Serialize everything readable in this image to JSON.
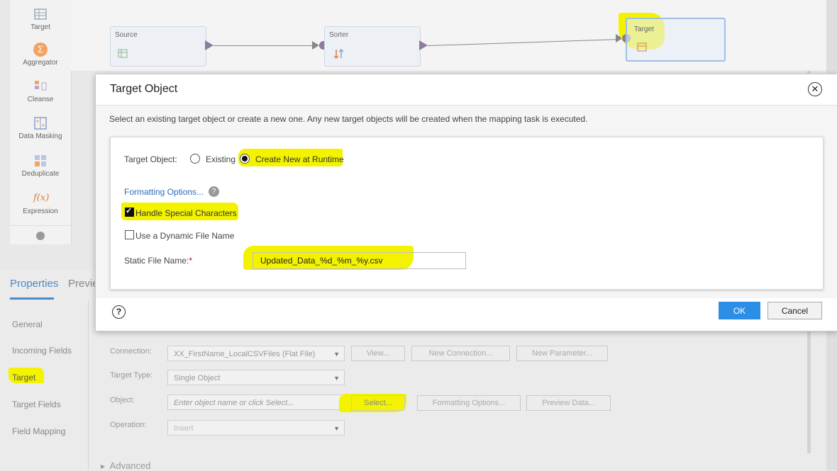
{
  "palette": {
    "items": [
      {
        "label": "Target",
        "icon": "target-icon"
      },
      {
        "label": "Aggregator",
        "icon": "aggregator-icon"
      },
      {
        "label": "Cleanse",
        "icon": "cleanse-icon"
      },
      {
        "label": "Data Masking",
        "icon": "data-masking-icon"
      },
      {
        "label": "Deduplicate",
        "icon": "deduplicate-icon"
      },
      {
        "label": "Expression",
        "icon": "expression-icon"
      }
    ],
    "expression_glyph": "f(x)",
    "aggregator_glyph": "Σ"
  },
  "canvas": {
    "nodes": [
      {
        "title": "Source"
      },
      {
        "title": "Sorter"
      },
      {
        "title": "Target"
      }
    ]
  },
  "bottom": {
    "tabs": {
      "properties": "Properties",
      "preview": "Previe"
    },
    "nav": [
      "General",
      "Incoming Fields",
      "Target",
      "Target Fields",
      "Field Mapping"
    ],
    "form": {
      "connection_label": "Connection:",
      "connection_value": "XX_FirstName_LocalCSVFiles (Flat File)",
      "view_button": "View...",
      "new_connection_button": "New Connection...",
      "new_parameter_button": "New Parameter...",
      "target_type_label": "Target Type:",
      "target_type_value": "Single Object",
      "object_label": "Object:",
      "object_placeholder": "Enter object name or click Select...",
      "select_button": "Select...",
      "formatting_options_button": "Formatting Options...",
      "preview_data_button": "Preview Data...",
      "operation_label": "Operation:",
      "operation_value": "Insert"
    },
    "advanced": "Advanced"
  },
  "modal": {
    "title": "Target Object",
    "description": "Select an existing target object or create a new one. Any new target objects will be created when the mapping task is executed.",
    "target_object_label": "Target Object:",
    "option_existing": "Existing",
    "option_create_new": "Create New at Runtime",
    "selected_option": "Create New at Runtime",
    "formatting_options_link": "Formatting Options...",
    "help_mark": "?",
    "handle_special_characters": "Handle Special Characters",
    "handle_special_characters_checked": true,
    "dynamic_file_name": "Use a Dynamic File Name",
    "dynamic_file_name_checked": false,
    "static_file_name_label": "Static File Name:",
    "required_mark": "*",
    "static_file_name_value": "Updated_Data_%d_%m_%y.csv",
    "ok_label": "OK",
    "cancel_label": "Cancel"
  },
  "colors": {
    "highlight": "#f3f300",
    "accent": "#2b8fe8",
    "link": "#2b6fb5",
    "tab_active": "#4a8ac4",
    "required": "#d0021b"
  }
}
